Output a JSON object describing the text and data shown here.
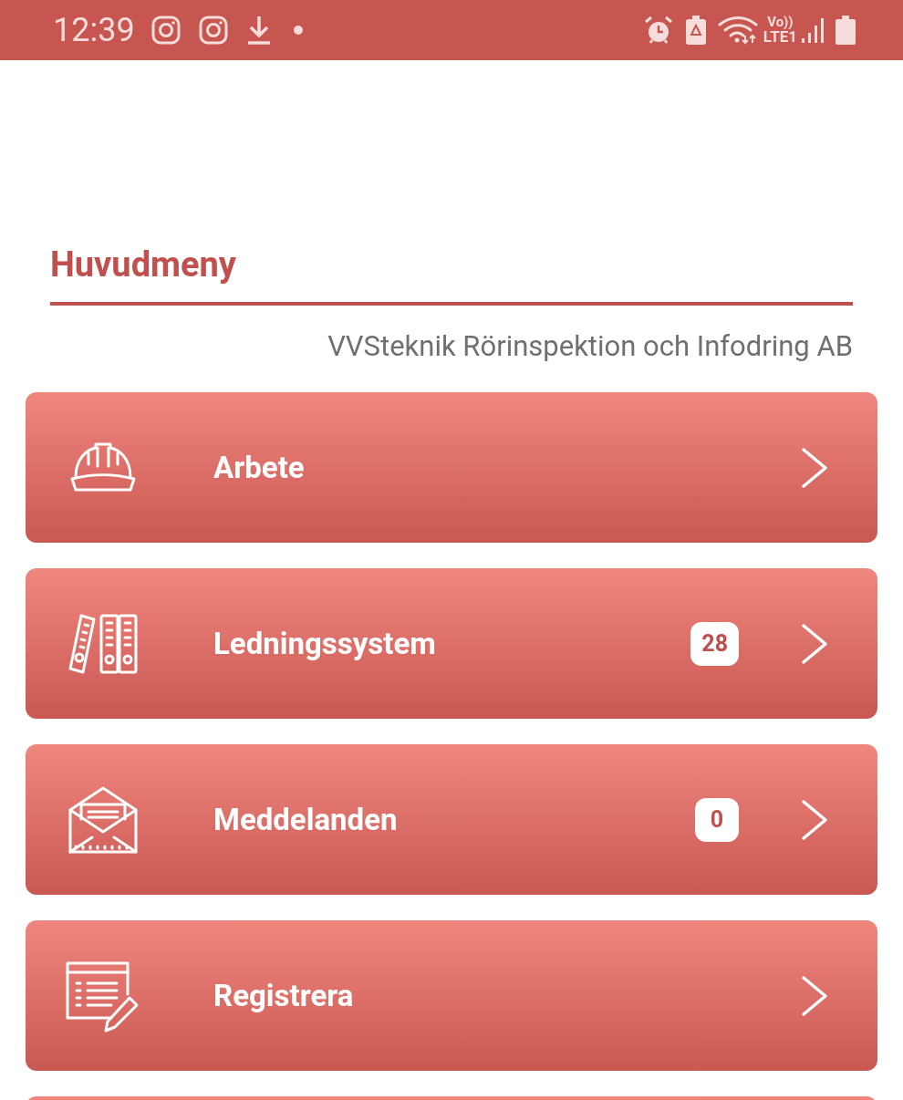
{
  "status_bar": {
    "time": "12:39",
    "network_top": "Vo))",
    "network_bottom": "LTE1"
  },
  "heading": "Huvudmeny",
  "company": "VVSteknik Rörinspektion och Infodring AB",
  "menu": [
    {
      "label": "Arbete"
    },
    {
      "label": "Ledningssystem",
      "badge": "28"
    },
    {
      "label": "Meddelanden",
      "badge": "0"
    },
    {
      "label": "Registrera"
    }
  ]
}
